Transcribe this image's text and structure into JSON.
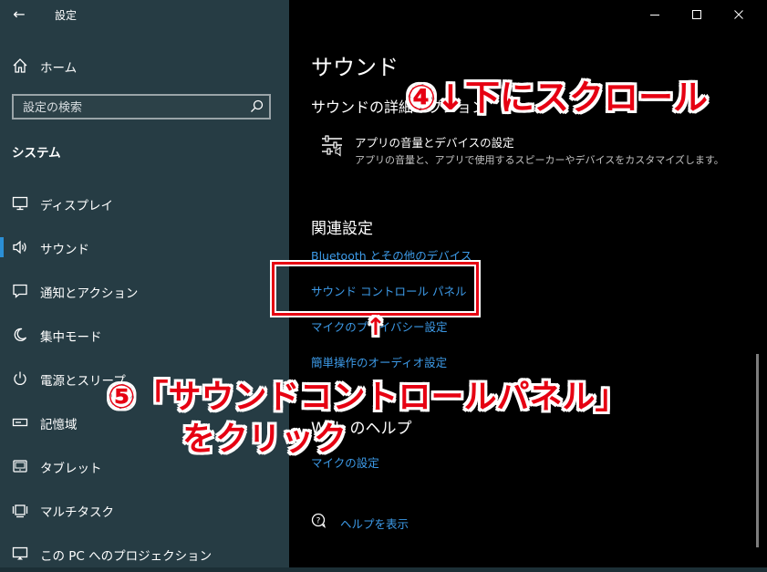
{
  "window": {
    "title": "設定",
    "back_icon": "←"
  },
  "sidebar": {
    "home_label": "ホーム",
    "search_placeholder": "設定の検索",
    "section_title": "システム",
    "items": [
      {
        "label": "ディスプレイ",
        "icon": "display-icon"
      },
      {
        "label": "サウンド",
        "icon": "speaker-icon",
        "selected": true
      },
      {
        "label": "通知とアクション",
        "icon": "notification-icon"
      },
      {
        "label": "集中モード",
        "icon": "moon-icon"
      },
      {
        "label": "電源とスリープ",
        "icon": "power-icon"
      },
      {
        "label": "記憶域",
        "icon": "storage-icon"
      },
      {
        "label": "タブレット",
        "icon": "tablet-icon"
      },
      {
        "label": "マルチタスク",
        "icon": "multitask-icon"
      },
      {
        "label": "この PC へのプロジェクション",
        "icon": "projection-icon"
      }
    ]
  },
  "main": {
    "page_title": "サウンド",
    "advanced_title": "サウンドの詳細オプション",
    "app_volume": {
      "title": "アプリの音量とデバイスの設定",
      "description": "アプリの音量と、アプリで使用するスピーカーやデバイスをカスタマイズします。"
    },
    "related_title": "関連設定",
    "related_links": [
      "Bluetooth とその他のデバイス",
      "サウンド コントロール パネル",
      "マイクのプライバシー設定",
      "簡単操作のオーディオ設定"
    ],
    "help_title": "Web のヘルプ",
    "help_links": [
      "マイクの設定"
    ],
    "show_help": "ヘルプを表示"
  },
  "annotations": {
    "scroll": "④↓下にスクロール",
    "click_line1": "⑤「サウンドコントロールパネル」",
    "click_line2": "をクリック",
    "arrow": "↑"
  },
  "colors": {
    "sidebar_bg": "#263c44",
    "accent": "#2b8fd6",
    "link": "#3d9be9",
    "annotation": "#e60012"
  }
}
